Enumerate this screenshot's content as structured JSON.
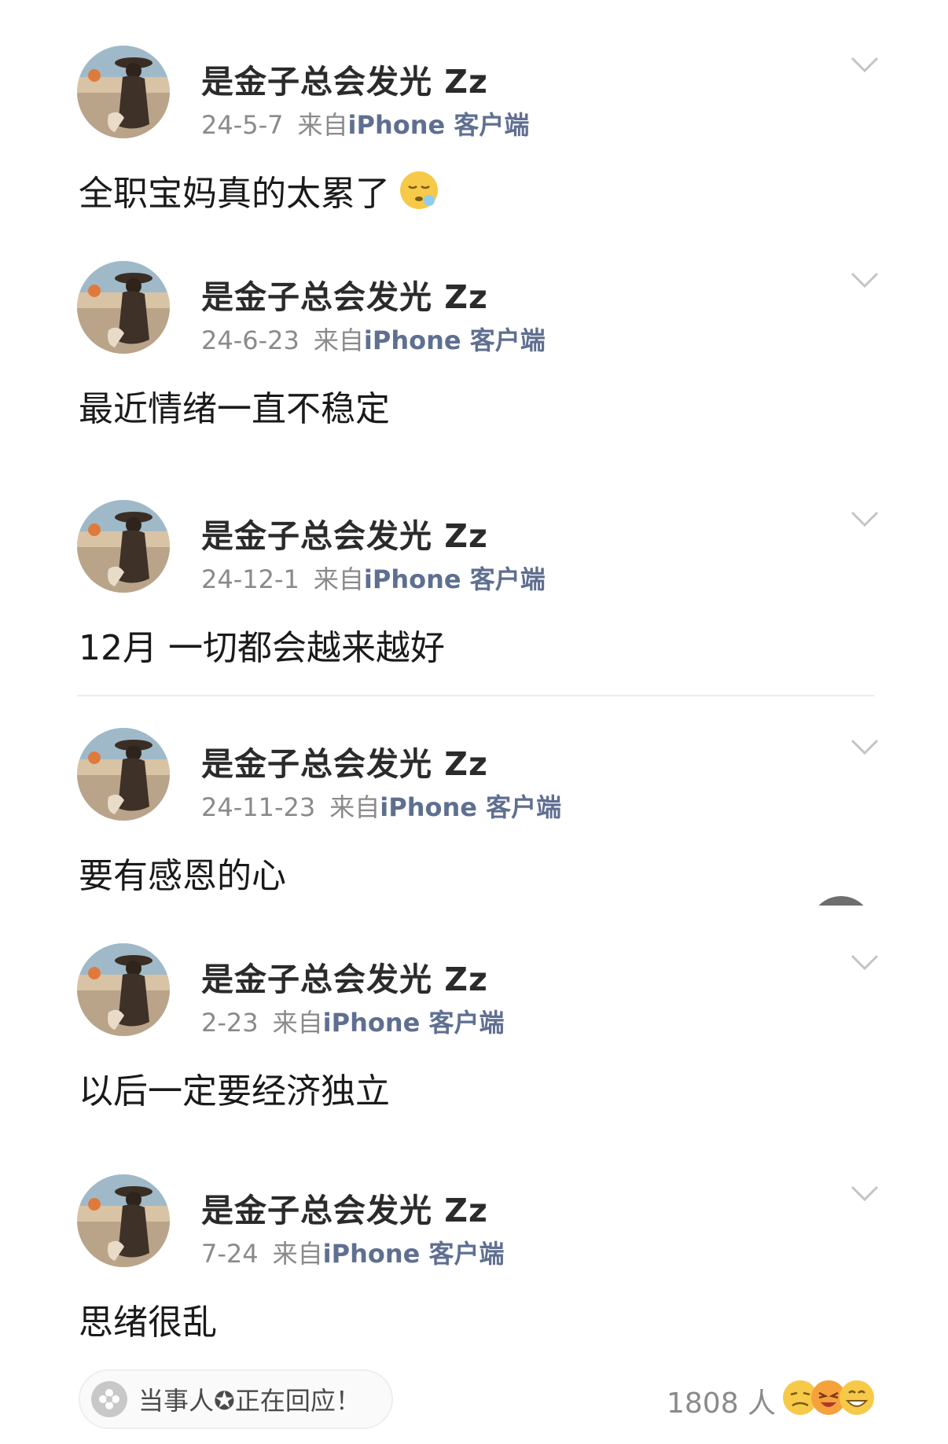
{
  "posts": [
    {
      "username": "是金子总会发光 Zz",
      "date": "24-5-7",
      "source_prefix": "来自",
      "device": "iPhone 客户端",
      "content": "全职宝妈真的太累了",
      "emoji": "sleepy-face-icon"
    },
    {
      "username": "是金子总会发光 Zz",
      "date": "24-6-23",
      "source_prefix": "来自",
      "device": "iPhone 客户端",
      "content": "最近情绪一直不稳定"
    },
    {
      "username": "是金子总会发光 Zz",
      "date": "24-12-1",
      "source_prefix": "来自",
      "device": "iPhone 客户端",
      "content": "12月 一切都会越来越好"
    },
    {
      "username": "是金子总会发光 Zz",
      "date": "24-11-23",
      "source_prefix": "来自",
      "device": "iPhone 客户端",
      "content": "要有感恩的心"
    },
    {
      "username": "是金子总会发光 Zz",
      "date": "2-23",
      "source_prefix": "来自",
      "device": "iPhone 客户端",
      "content": "以后一定要经济独立"
    },
    {
      "username": "是金子总会发光 Zz",
      "date": "7-24",
      "source_prefix": "来自",
      "device": "iPhone 客户端",
      "content": "思绪很乱"
    }
  ],
  "bottom_bar": {
    "status_text": "当事人✪正在回应！",
    "count_text": "1808 人",
    "reaction_icons": [
      "smirk-face-icon",
      "laughing-crying-face-icon",
      "grinning-face-icon"
    ]
  },
  "colors": {
    "device_link": "#5f6f91",
    "meta_gray": "#8a8a8a",
    "text": "#1a1a1a"
  }
}
